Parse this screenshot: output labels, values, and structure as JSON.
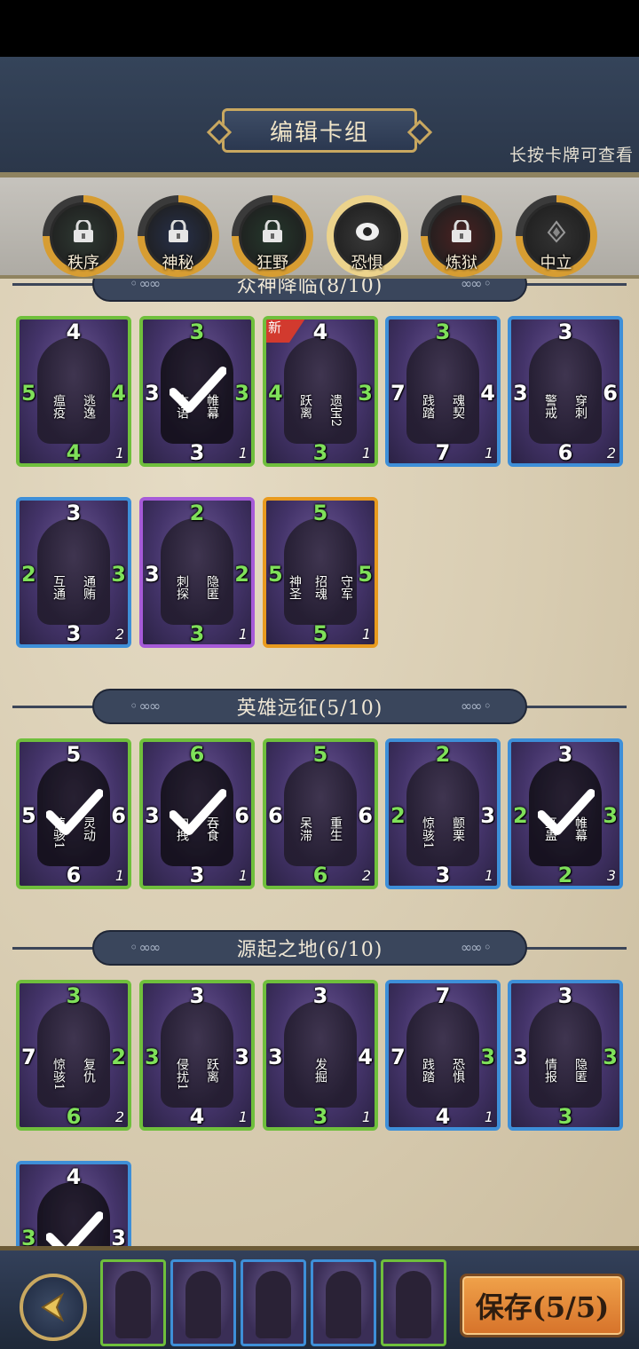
{
  "header": {
    "title": "编辑卡组",
    "hint": "长按卡牌可查看"
  },
  "factions": [
    {
      "label": "秩序",
      "locked": true,
      "color": "#2f3a33"
    },
    {
      "label": "神秘",
      "locked": true,
      "color": "#27304a"
    },
    {
      "label": "狂野",
      "locked": true,
      "color": "#25382c"
    },
    {
      "label": "恐惧",
      "locked": false,
      "active": true,
      "color": "#3a3a3a"
    },
    {
      "label": "炼狱",
      "locked": true,
      "color": "#4a2222"
    },
    {
      "label": "中立",
      "locked": false,
      "color": "#333333"
    }
  ],
  "sections": [
    {
      "title": "众神降临(8/10)",
      "cards": [
        {
          "cost": "4",
          "atk": "5",
          "hp": "4",
          "bottom": "4",
          "count": "1",
          "keywords": [
            "瘟疫",
            "逃逸"
          ],
          "rarity": "green",
          "atk_buff": true,
          "hp_buff": true,
          "bottom_buff": true,
          "used": false,
          "new": false
        },
        {
          "cost": "3",
          "atk": "3",
          "hp": "3",
          "bottom": "3",
          "count": "1",
          "keywords": [
            "亡语",
            "帷幕"
          ],
          "rarity": "green",
          "cost_buff": true,
          "hp_buff": true,
          "used": true,
          "new": false
        },
        {
          "cost": "4",
          "atk": "4",
          "hp": "3",
          "bottom": "3",
          "count": "1",
          "keywords": [
            "跃离",
            "遗宝2"
          ],
          "rarity": "green",
          "atk_buff": true,
          "hp_buff": true,
          "bottom_buff": true,
          "used": false,
          "new": true,
          "new_label": "新"
        },
        {
          "cost": "3",
          "atk": "7",
          "hp": "4",
          "bottom": "7",
          "count": "1",
          "keywords": [
            "践踏",
            "魂契"
          ],
          "rarity": "blue",
          "cost_buff": true,
          "used": false,
          "new": false
        },
        {
          "cost": "3",
          "atk": "3",
          "hp": "6",
          "bottom": "6",
          "count": "2",
          "keywords": [
            "警戒",
            "穿刺"
          ],
          "rarity": "blue",
          "used": false,
          "new": false
        },
        {
          "cost": "3",
          "atk": "2",
          "hp": "3",
          "bottom": "3",
          "count": "2",
          "keywords": [
            "互通",
            "通贿"
          ],
          "rarity": "blue",
          "atk_buff": true,
          "hp_buff": true,
          "used": false,
          "new": false
        },
        {
          "cost": "2",
          "atk": "3",
          "hp": "2",
          "bottom": "3",
          "count": "1",
          "keywords": [
            "刺探",
            "隐匿"
          ],
          "rarity": "purple",
          "cost_buff": true,
          "hp_buff": true,
          "bottom_buff": true,
          "used": false,
          "new": false
        },
        {
          "cost": "5",
          "atk": "5",
          "hp": "5",
          "bottom": "5",
          "count": "1",
          "keywords": [
            "神圣",
            "招魂",
            "守军"
          ],
          "rarity": "gold",
          "cost_buff": true,
          "atk_buff": true,
          "hp_buff": true,
          "bottom_buff": true,
          "used": false,
          "new": false
        }
      ]
    },
    {
      "title": "英雄远征(5/10)",
      "cards": [
        {
          "cost": "5",
          "atk": "5",
          "hp": "6",
          "bottom": "6",
          "count": "1",
          "keywords": [
            "惊骇1",
            "灵动"
          ],
          "rarity": "green",
          "used": true,
          "new": false
        },
        {
          "cost": "6",
          "atk": "3",
          "hp": "6",
          "bottom": "3",
          "count": "1",
          "keywords": [
            "勾拽",
            "吞食"
          ],
          "rarity": "green",
          "cost_buff": true,
          "used": true,
          "new": false
        },
        {
          "cost": "5",
          "atk": "6",
          "hp": "6",
          "bottom": "6",
          "count": "2",
          "keywords": [
            "呆滞",
            "重生"
          ],
          "rarity": "green",
          "cost_buff": true,
          "bottom_buff": true,
          "used": false,
          "new": false
        },
        {
          "cost": "2",
          "atk": "2",
          "hp": "3",
          "bottom": "3",
          "count": "1",
          "keywords": [
            "惊骇1",
            "颤栗"
          ],
          "rarity": "blue",
          "cost_buff": true,
          "atk_buff": true,
          "used": false,
          "new": false
        },
        {
          "cost": "3",
          "atk": "2",
          "hp": "3",
          "bottom": "2",
          "count": "3",
          "keywords": [
            "巫蛊",
            "帷幕"
          ],
          "rarity": "blue",
          "atk_buff": true,
          "hp_buff": true,
          "bottom_buff": true,
          "used": true,
          "new": false
        }
      ]
    },
    {
      "title": "源起之地(6/10)",
      "cards": [
        {
          "cost": "3",
          "atk": "7",
          "hp": "2",
          "bottom": "6",
          "count": "2",
          "keywords": [
            "惊骇1",
            "复仇"
          ],
          "rarity": "green",
          "cost_buff": true,
          "hp_buff": true,
          "bottom_buff": true,
          "used": false,
          "new": false
        },
        {
          "cost": "3",
          "atk": "3",
          "hp": "3",
          "bottom": "4",
          "count": "1",
          "keywords": [
            "侵扰1",
            "跃离"
          ],
          "rarity": "green",
          "atk_buff": true,
          "used": false,
          "new": false
        },
        {
          "cost": "3",
          "atk": "3",
          "hp": "4",
          "bottom": "3",
          "count": "1",
          "keywords": [
            "发掘"
          ],
          "rarity": "green",
          "bottom_buff": true,
          "used": false,
          "new": false
        },
        {
          "cost": "7",
          "atk": "7",
          "hp": "3",
          "bottom": "4",
          "count": "1",
          "keywords": [
            "践踏",
            "恐惧"
          ],
          "rarity": "blue",
          "hp_buff": true,
          "used": false,
          "new": false
        },
        {
          "cost": "3",
          "atk": "3",
          "hp": "3",
          "bottom": "3",
          "count": "",
          "keywords": [
            "情报",
            "隐匿"
          ],
          "rarity": "blue",
          "hp_buff": true,
          "bottom_buff": true,
          "used": false,
          "new": false
        },
        {
          "cost": "4",
          "atk": "3",
          "hp": "3",
          "bottom": "",
          "count": "",
          "keywords": [],
          "rarity": "blue",
          "atk_buff": true,
          "used": true,
          "new": false
        }
      ]
    }
  ],
  "bottom_bar": {
    "back_label": "",
    "deck_slots": [
      {
        "rarity": "green"
      },
      {
        "rarity": "blue"
      },
      {
        "rarity": "blue"
      },
      {
        "rarity": "blue"
      },
      {
        "rarity": "green"
      }
    ],
    "save_label": "保存(5/5)"
  }
}
